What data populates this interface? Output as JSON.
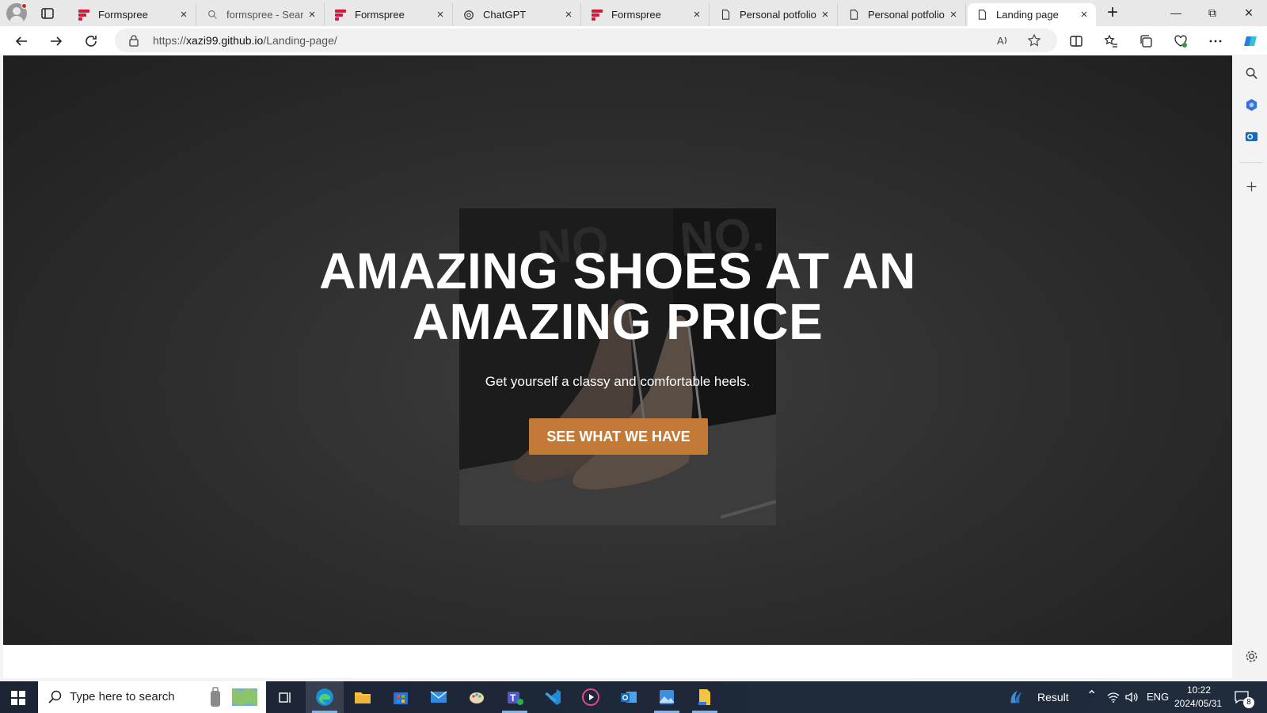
{
  "browser": {
    "tabs": [
      {
        "title": "Formspree",
        "icon": "formspree-icon"
      },
      {
        "title": "formspree - Search",
        "icon": "search-icon"
      },
      {
        "title": "Formspree",
        "icon": "formspree-icon"
      },
      {
        "title": "ChatGPT",
        "icon": "chatgpt-icon"
      },
      {
        "title": "Formspree",
        "icon": "formspree-icon"
      },
      {
        "title": "Personal potfolio",
        "icon": "page-icon"
      },
      {
        "title": "Personal potfolio",
        "icon": "page-icon"
      },
      {
        "title": "Landing page",
        "icon": "page-icon",
        "active": true
      }
    ],
    "url_prefix": "https://",
    "url_host": "xazi99.github.io",
    "url_path": "/Landing-page/"
  },
  "page": {
    "title_line1": "AMAZING SHOES AT AN",
    "title_line2": "AMAZING PRICE",
    "subtitle": "Get yourself a classy and comfortable heels.",
    "cta_label": "SEE WHAT WE HAVE",
    "accent_color": "#c47a37",
    "overlay_color": "#2c2c2c"
  },
  "taskbar": {
    "search_placeholder": "Type here to search",
    "weather_label": "Result",
    "language": "ENG",
    "time": "10:22",
    "date": "2024/05/31",
    "notification_count": "8"
  }
}
